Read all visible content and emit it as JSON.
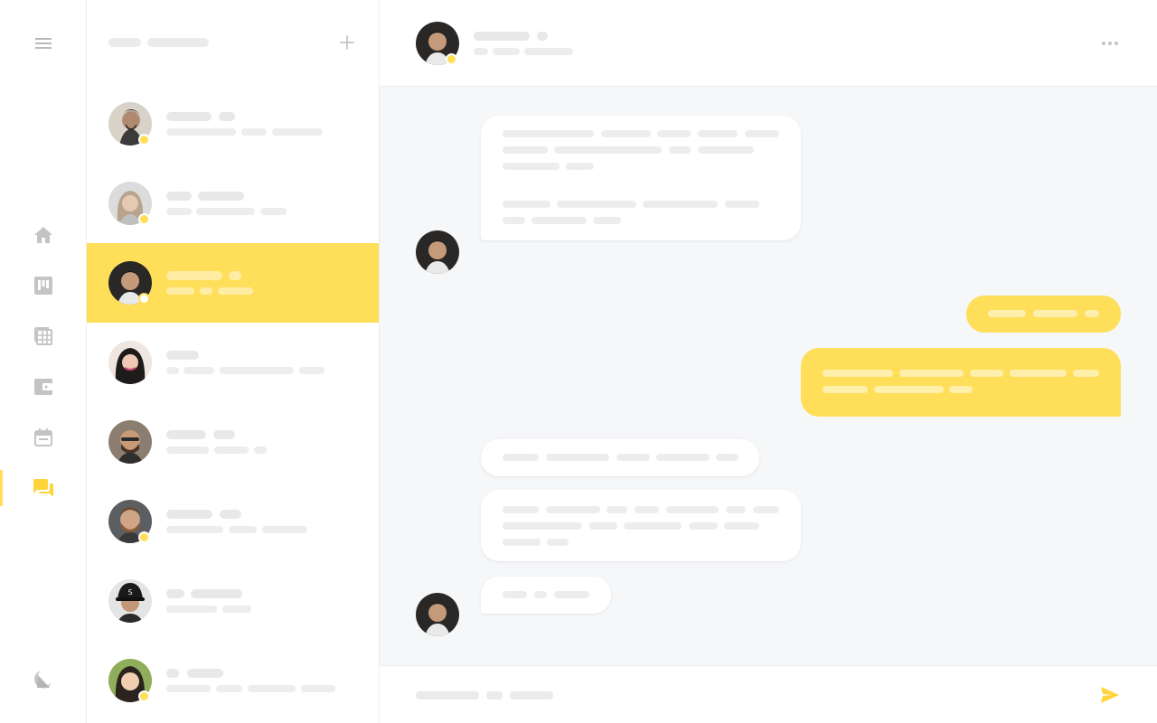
{
  "theme": {
    "accent": "#ffde59",
    "background": "#f6f7f8",
    "skeleton": "#ebebeb"
  },
  "rail": {
    "items": [
      {
        "icon": "menu-icon"
      },
      {
        "icon": "home-icon"
      },
      {
        "icon": "board-icon"
      },
      {
        "icon": "spreadsheet-icon"
      },
      {
        "icon": "wallet-icon"
      },
      {
        "icon": "calendar-icon"
      },
      {
        "icon": "chat-icon",
        "active": true
      },
      {
        "icon": "theme-toggle-icon"
      }
    ]
  },
  "conversation_list": {
    "add_icon": "plus-icon",
    "selected_index": 2,
    "online_status": [
      true,
      true,
      true,
      false,
      false,
      true,
      false,
      true
    ]
  },
  "chat": {
    "more_icon": "more-horizontal-icon",
    "send_icon": "send-icon"
  }
}
